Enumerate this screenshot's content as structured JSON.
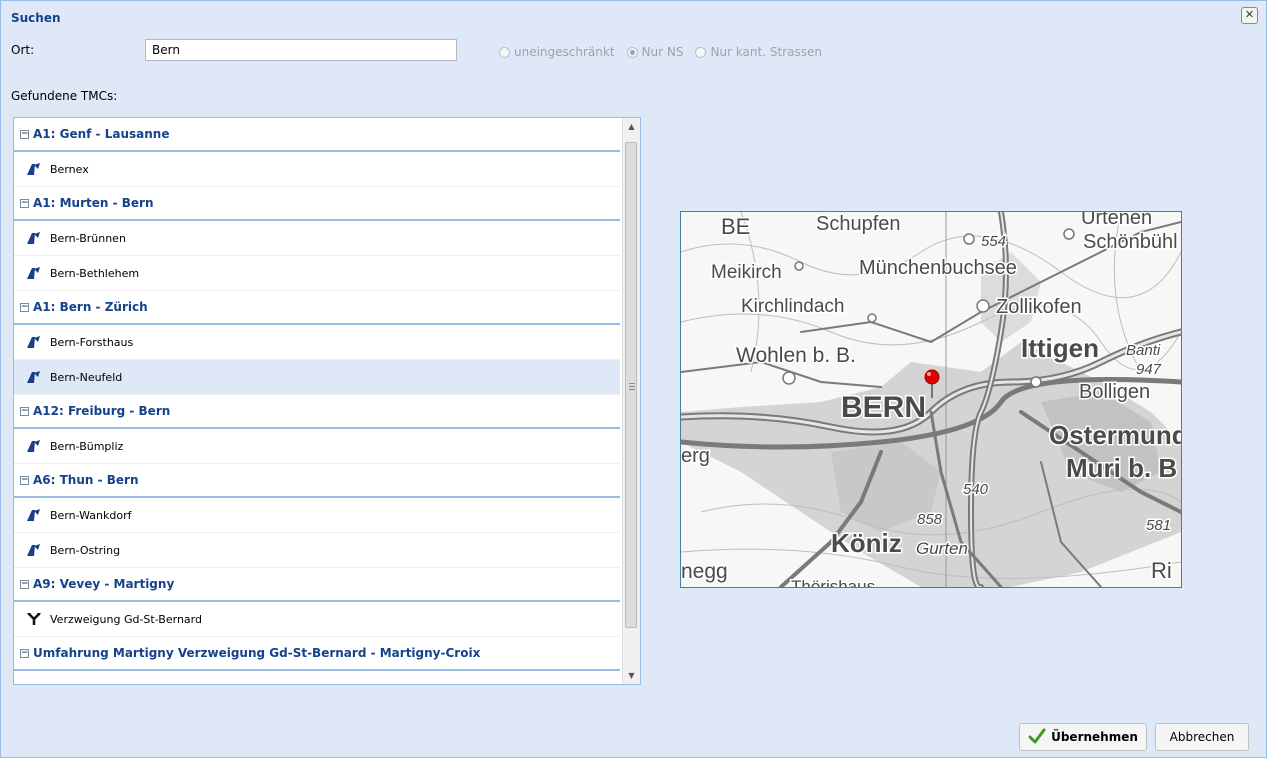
{
  "dialog": {
    "title": "Suchen",
    "close_glyph": "✕",
    "close_icon": "close-icon"
  },
  "search": {
    "ort_label": "Ort:",
    "ort_value": "Bern",
    "filter_options": [
      {
        "label": "uneingeschränkt",
        "checked": false
      },
      {
        "label": "Nur NS",
        "checked": true
      },
      {
        "label": "Nur kant. Strassen",
        "checked": false
      }
    ]
  },
  "results": {
    "label": "Gefundene TMCs:",
    "groups": [
      {
        "title": "A1: Genf - Lausanne",
        "items": [
          {
            "label": "Bernex",
            "icon": "motorway-exit-icon"
          }
        ]
      },
      {
        "title": "A1: Murten - Bern",
        "items": [
          {
            "label": "Bern-Brünnen",
            "icon": "motorway-exit-icon"
          },
          {
            "label": "Bern-Bethlehem",
            "icon": "motorway-exit-icon"
          }
        ]
      },
      {
        "title": "A1: Bern - Zürich",
        "items": [
          {
            "label": "Bern-Forsthaus",
            "icon": "motorway-exit-icon"
          },
          {
            "label": "Bern-Neufeld",
            "icon": "motorway-exit-icon",
            "selected": true
          }
        ]
      },
      {
        "title": "A12: Freiburg - Bern",
        "items": [
          {
            "label": "Bern-Bümpliz",
            "icon": "motorway-exit-icon"
          }
        ]
      },
      {
        "title": "A6: Thun - Bern",
        "items": [
          {
            "label": "Bern-Wankdorf",
            "icon": "motorway-exit-icon"
          },
          {
            "label": "Bern-Ostring",
            "icon": "motorway-exit-icon"
          }
        ]
      },
      {
        "title": "A9: Vevey - Martigny",
        "items": [
          {
            "label": "Verzweigung Gd-St-Bernard",
            "icon": "junction-icon"
          }
        ]
      },
      {
        "title": "Umfahrung Martigny Verzweigung Gd-St-Bernard - Martigny-Croix",
        "items": []
      }
    ]
  },
  "map": {
    "labels": {
      "be": "BE",
      "schupfen": "Schupfen",
      "schoenbuehl": "Schönbühl",
      "urtenen": "Urtenen",
      "n554": "554",
      "meikirch": "Meikirch",
      "muenchenbuchsee": "Münchenbuchsee",
      "kirchlindach": "Kirchlindach",
      "zollikofen": "Zollikofen",
      "wohlen": "Wohlen b. B.",
      "ittigen": "Ittigen",
      "banti": "Banti",
      "n947": "947",
      "bern": "BERN",
      "bolligen": "Bolligen",
      "ostermundigen": "Ostermund",
      "erg": "erg",
      "muri": "Muri b. B",
      "n540": "540",
      "n858": "858",
      "n581": "581",
      "koeniz": "Köniz",
      "gurten": "Gurten",
      "negg": "negg",
      "thoerishaus": "Thörishaus",
      "ri": "Ri"
    }
  },
  "buttons": {
    "ok_label": "Übernehmen",
    "cancel_label": "Abbrechen"
  },
  "colors": {
    "header_blue": "#15428b",
    "border_blue": "#99bbe8",
    "marker_red": "#e00000",
    "ok_check_green": "#3a9a23"
  }
}
